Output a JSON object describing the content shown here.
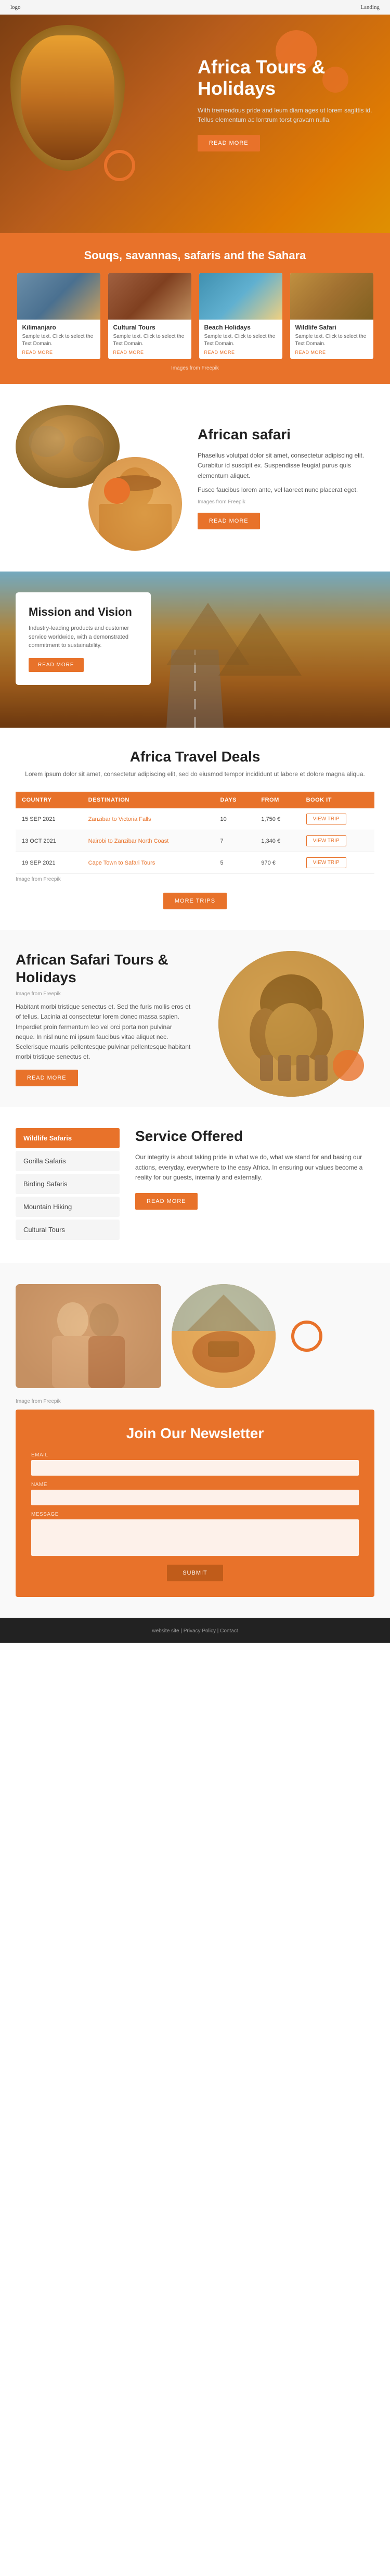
{
  "header": {
    "logo": "logo",
    "nav": "Landing"
  },
  "hero": {
    "title": "Africa Tours & Holidays",
    "text": "With tremendous pride and leum diam ages ut lorem sagittis id. Tellus elementum ac lorrtrum torst gravam nulla.",
    "btn_label": "READ MORE"
  },
  "orange_section": {
    "title": "Souqs, savannas, safaris and the Sahara",
    "cards": [
      {
        "id": "kilimanjaro",
        "title": "Kilimanjaro",
        "text": "Sample text. Click to select the Text Domain.",
        "link": "READ MORE"
      },
      {
        "id": "cultural",
        "title": "Cultural Tours",
        "text": "Sample text. Click to select the Text Domain.",
        "link": "READ MORE"
      },
      {
        "id": "beach",
        "title": "Beach Holidays",
        "text": "Sample text. Click to select the Text Domain.",
        "link": "READ MORE"
      },
      {
        "id": "wildlife",
        "title": "Wildlife Safari",
        "text": "Sample text. Click to select the Text Domain.",
        "link": "READ MORE"
      }
    ],
    "source": "Images from Freepik"
  },
  "safari": {
    "title": "African safari",
    "text1": "Phasellus volutpat dolor sit amet, consectetur adipiscing elit. Curabitur id suscipit ex. Suspendisse feugiat purus quis elementum aliquet.",
    "text2": "Fusce faucibus lorem ante, vel laoreet nunc placerat eget.",
    "source": "Images from Freepik",
    "btn_label": "READ MORE"
  },
  "mission": {
    "title": "Mission and Vision",
    "text": "Industry-leading products and customer service worldwide, with a demonstrated commitment to sustainability.",
    "btn_label": "READ MORE"
  },
  "deals": {
    "title": "Africa Travel Deals",
    "subtitle": "Lorem ipsum dolor sit amet, consectetur adipiscing elit, sed do eiusmod tempor incididunt ut labore et dolore magna aliqua.",
    "columns": [
      "COUNTRY",
      "DESTINATION",
      "DAYS",
      "FROM",
      "BOOK IT"
    ],
    "rows": [
      {
        "date": "15 SEP 2021",
        "destination": "Zanzibar to Victoria Falls",
        "days": "10",
        "price": "1,750 €",
        "btn": "VIEW TRIP"
      },
      {
        "date": "13 OCT 2021",
        "destination": "Nairobi to Zanzibar North Coast",
        "days": "7",
        "price": "1,340 €",
        "btn": "VIEW TRIP"
      },
      {
        "date": "19 SEP 2021",
        "destination": "Cape Town to Safari Tours",
        "days": "5",
        "price": "970 €",
        "btn": "VIEW TRIP"
      }
    ],
    "source": "Image from Freepik",
    "btn_label": "MORE TRIPS"
  },
  "tours": {
    "title": "African Safari Tours & Holidays",
    "source": "Image from Freepik",
    "text": "Habitant morbi tristique senectus et. Sed the furis mollis eros et of tellus. Lacinia at consectetur lorem donec massa sapien. Imperdiet proin fermentum leo vel orci porta non pulvinar neque. In nisl nunc mi ipsum faucibus vitae aliquet nec. Scelerisque mauris pellentesque pulvinar pellentesque habitant morbi tristique senectus et.",
    "btn_label": "READ MORE"
  },
  "service": {
    "title": "Service Offered",
    "text": "Our integrity is about taking pride in what we do, what we stand for and basing our actions, everyday, everywhere to the easy Africa. In ensuring our values become a reality for our guests, internally and externally.",
    "btn_label": "READ MORE",
    "menu": [
      {
        "id": "wildlife",
        "label": "Wildlife Safaris",
        "active": true
      },
      {
        "id": "gorilla",
        "label": "Gorilla Safaris",
        "active": false
      },
      {
        "id": "birding",
        "label": "Birding Safaris",
        "active": false
      },
      {
        "id": "mountain",
        "label": "Mountain Hiking",
        "active": false
      },
      {
        "id": "cultural",
        "label": "Cultural Tours",
        "active": false
      }
    ]
  },
  "newsletter": {
    "title": "Join Our Newsletter",
    "source": "Image from Freepik",
    "fields": [
      {
        "id": "email",
        "label": "Email",
        "placeholder": ""
      },
      {
        "id": "name",
        "label": "Name",
        "placeholder": ""
      },
      {
        "id": "message",
        "label": "Message",
        "placeholder": ""
      }
    ],
    "submit_label": "SUBMIT"
  },
  "footer": {
    "text": "website site | Privacy Policy | Contact"
  }
}
